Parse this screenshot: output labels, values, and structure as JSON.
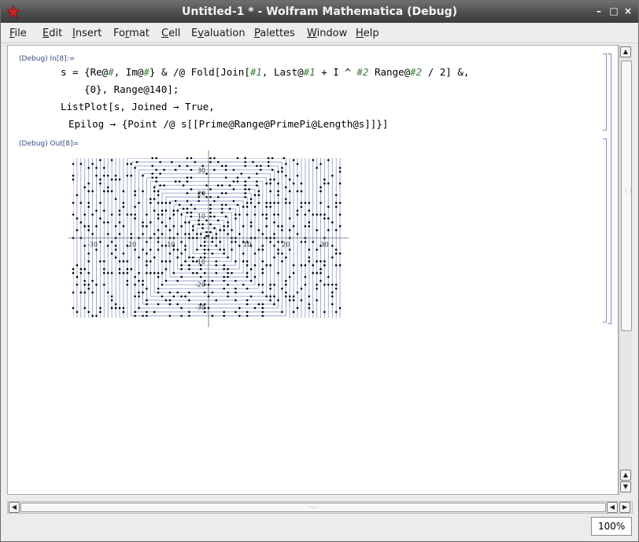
{
  "window": {
    "title": "Untitled-1 * - Wolfram Mathematica (Debug)",
    "minimize_glyph": "–",
    "maximize_glyph": "□",
    "close_glyph": "×"
  },
  "menu": {
    "items": [
      {
        "u": "F",
        "rest": "ile"
      },
      {
        "u": "E",
        "rest": "dit"
      },
      {
        "u": "I",
        "rest": "nsert"
      },
      {
        "pre": "Fo",
        "u": "r",
        "rest": "mat"
      },
      {
        "u": "C",
        "rest": "ell"
      },
      {
        "pre": "E",
        "u": "v",
        "rest": "aluation"
      },
      {
        "u": "P",
        "rest": "alettes"
      },
      {
        "u": "W",
        "rest": "indow"
      },
      {
        "u": "H",
        "rest": "elp"
      }
    ]
  },
  "notebook": {
    "input_label": "(Debug) In[8]:=",
    "output_label": "(Debug) Out[8]=",
    "code": {
      "l1a": "s = {Re@",
      "l1b": "#",
      "l1c": ", Im@",
      "l1d": "#",
      "l1e": "} & /@ Fold[Join[",
      "l1f": "#1",
      "l1g": ", Last@",
      "l1h": "#1",
      "l1i": " + I ^ ",
      "l1j": "#2",
      "l1k": " Range@",
      "l1l": "#2",
      "l1m": " / 2] &,",
      "l2": "{0}, Range@140];",
      "l3": "ListPlot[s, Joined → True,",
      "l4": "Epilog → {Point /@ s[[Prime@Range@PrimePi@Length@s]]}]"
    }
  },
  "plot": {
    "x_ticks": [
      "-30",
      "-20",
      "-10",
      "10",
      "20",
      "30"
    ],
    "y_ticks": [
      "30",
      "20",
      "10",
      "-10",
      "-20",
      "-30"
    ],
    "line_color": "#8fa6cf",
    "point_color": "#000000"
  },
  "scroll": {
    "up_glyph": "▲",
    "down_glyph": "▼",
    "left_glyph": "◀",
    "right_glyph": "▶"
  },
  "status": {
    "zoom": "100%"
  },
  "colors": {
    "titlebar": "#4d4d4d",
    "cell_label": "#3b4a8a",
    "slot_green": "#3d7a3d",
    "bracket": "#7b8fc0"
  }
}
